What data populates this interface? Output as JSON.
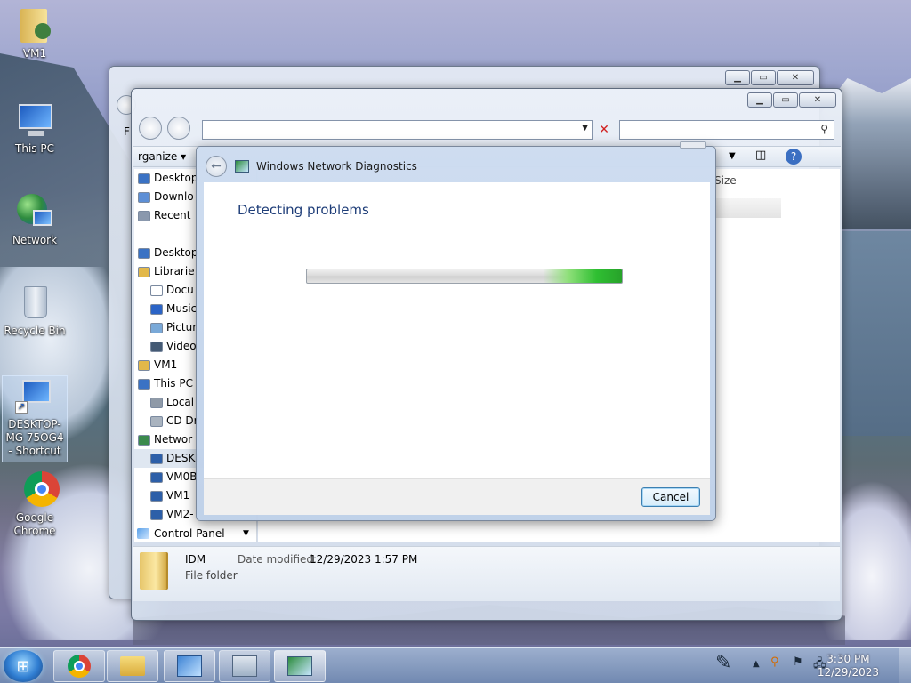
{
  "desktop": {
    "icons": [
      {
        "label": "VM1"
      },
      {
        "label": "This PC"
      },
      {
        "label": "Network"
      },
      {
        "label": "Recycle Bin"
      },
      {
        "label": "DESKTOP-MG 75OG4 - Shortcut"
      },
      {
        "label": "Google Chrome"
      }
    ]
  },
  "explorer_back": {
    "menu_partial": "F"
  },
  "explorer_front": {
    "toolbar": {
      "organize_label": "rganize ▾"
    },
    "nav_tree": [
      {
        "label": "Desktop",
        "indent": 0
      },
      {
        "label": "Downlo",
        "indent": 0
      },
      {
        "label": "Recent",
        "indent": 0
      },
      {
        "label": "",
        "indent": 0
      },
      {
        "label": "Desktop",
        "indent": 0
      },
      {
        "label": "Librarie",
        "indent": 0
      },
      {
        "label": "Docu",
        "indent": 1
      },
      {
        "label": "Music",
        "indent": 1
      },
      {
        "label": "Pictur",
        "indent": 1
      },
      {
        "label": "Video",
        "indent": 1
      },
      {
        "label": "VM1",
        "indent": 0
      },
      {
        "label": "This PC",
        "indent": 0
      },
      {
        "label": "Local",
        "indent": 1
      },
      {
        "label": "CD Dr",
        "indent": 1
      },
      {
        "label": "Networ",
        "indent": 0
      },
      {
        "label": "DESKT",
        "indent": 1
      },
      {
        "label": "VM0B",
        "indent": 1
      },
      {
        "label": "VM1",
        "indent": 1
      },
      {
        "label": "VM2-",
        "indent": 1
      }
    ],
    "control_panel_label": "Control Panel",
    "column_size": "Size",
    "details": {
      "name": "IDM",
      "type": "File folder",
      "modified_label": "Date modified:",
      "modified_value": "12/29/2023 1:57 PM"
    }
  },
  "dialog": {
    "title": "Windows Network Diagnostics",
    "heading": "Detecting problems",
    "progress_fraction": 1.0,
    "cancel_label": "Cancel"
  },
  "taskbar": {
    "time": "3:30 PM",
    "date": "12/29/2023"
  },
  "colors": {
    "dialog_heading": "#1e3d78",
    "progress_green": "#2fbf32",
    "taskbar": "#8aa2c6"
  }
}
